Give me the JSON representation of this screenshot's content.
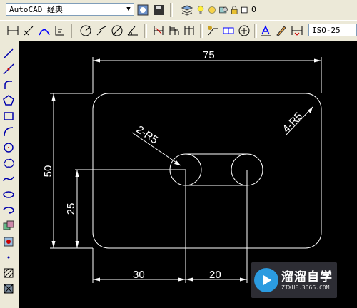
{
  "toolbar": {
    "workspace": "AutoCAD 经典",
    "layer_value": "0",
    "dimstyle": "ISO-25"
  },
  "dimensions": {
    "width": "75",
    "height": "50",
    "hole_height": "25",
    "hole_x": "30",
    "slot_length": "20",
    "small_radius": "2-R5",
    "corner_radius": "4-R5"
  },
  "watermark": {
    "title": "溜溜自学",
    "url": "ZIXUE.3D66.COM"
  },
  "colors": {
    "canvas_bg": "#000000",
    "geometry": "#ffffff",
    "toolbar_bg": "#ece9d8"
  }
}
